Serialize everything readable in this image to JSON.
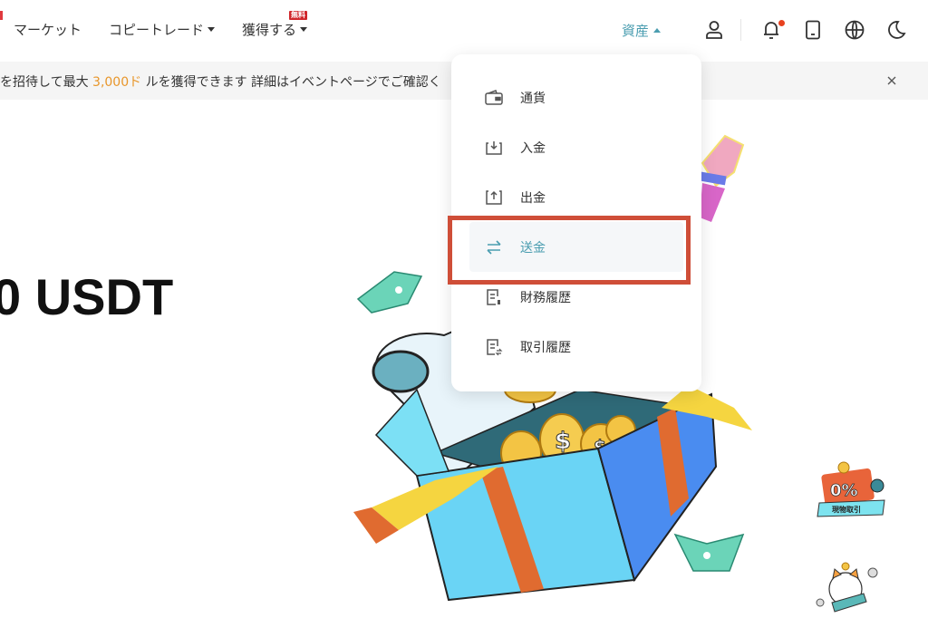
{
  "header": {
    "nav": [
      {
        "label": "マーケット",
        "has_caret": false
      },
      {
        "label": "コピートレード",
        "has_caret": true
      },
      {
        "label": "獲得する",
        "has_caret": true,
        "badge": "無料"
      }
    ],
    "assets_label": "資産",
    "icons": [
      "user-icon",
      "bell-icon",
      "mobile-icon",
      "globe-icon",
      "moon-icon"
    ],
    "notification_dot": true
  },
  "banner": {
    "text_before": "を招待して最大",
    "highlight": "3,000ド",
    "text_after": "ルを獲得できます 詳細はイベントページでご確認く"
  },
  "hero": {
    "amount": "0 USDT"
  },
  "dropdown": {
    "items": [
      {
        "label": "通貨",
        "icon": "wallet-icon",
        "active": false
      },
      {
        "label": "入金",
        "icon": "deposit-icon",
        "active": false
      },
      {
        "label": "出金",
        "icon": "withdraw-icon",
        "active": false
      },
      {
        "label": "送金",
        "icon": "transfer-icon",
        "active": true
      },
      {
        "label": "財務履歴",
        "icon": "financial-history-icon",
        "active": false
      },
      {
        "label": "取引履歴",
        "icon": "trade-history-icon",
        "active": false
      }
    ]
  },
  "side_promos": [
    {
      "title": "0%",
      "caption": "現物取引"
    },
    {
      "caption": "lucky cat promo"
    }
  ],
  "colors": {
    "accent": "#4a9db0",
    "highlight_orange": "#e8962a",
    "annotation_red": "#cf4e38",
    "badge_red": "#d0262b",
    "notification_dot": "#e8421f"
  }
}
